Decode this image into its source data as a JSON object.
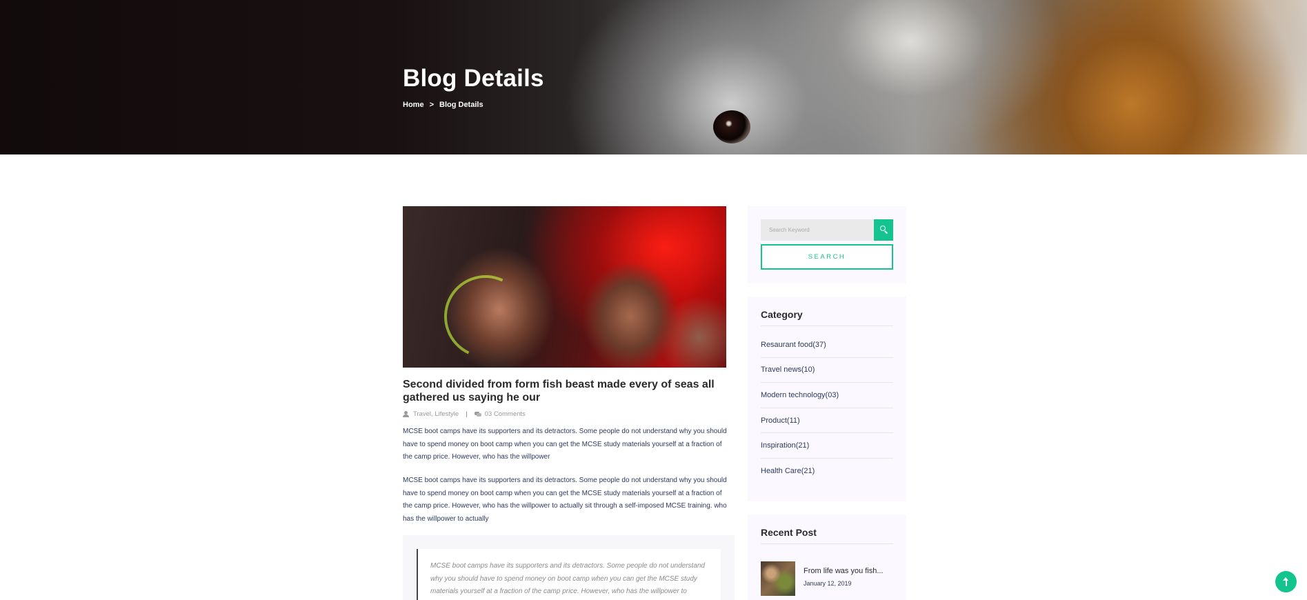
{
  "hero": {
    "title": "Blog Details",
    "breadcrumb": {
      "home": "Home",
      "separator": ">",
      "current": "Blog Details"
    }
  },
  "post": {
    "title": "Second divided from form fish beast made every of seas all gathered us saying he our",
    "meta": {
      "categories": "Travel, Lifestyle",
      "divider": "|",
      "comments": "03 Comments"
    },
    "paragraphs": [
      "MCSE boot camps have its supporters and its detractors. Some people do not understand why you should have to spend money on boot camp when you can get the MCSE study materials yourself at a fraction of the camp price. However, who has the willpower",
      "MCSE boot camps have its supporters and its detractors. Some people do not understand why you should have to spend money on boot camp when you can get the MCSE study materials yourself at a fraction of the camp price. However, who has the willpower to actually sit through a self-imposed MCSE training. who has the willpower to actually"
    ],
    "quote": "MCSE boot camps have its supporters and its detractors. Some people do not understand why you should have to spend money on boot camp when you can get the MCSE study materials yourself at a fraction of the camp price. However, who has the willpower to actually sit through a self-imposed MCSE training."
  },
  "sidebar": {
    "search": {
      "placeholder": "Search Keyword",
      "button_label": "SEARCH"
    },
    "category": {
      "title": "Category",
      "items": [
        {
          "label": "Resaurant food(37)"
        },
        {
          "label": "Travel news(10)"
        },
        {
          "label": "Modern technology(03)"
        },
        {
          "label": "Product(11)"
        },
        {
          "label": "Inspiration(21)"
        },
        {
          "label": "Health Care(21)"
        }
      ]
    },
    "recent": {
      "title": "Recent Post",
      "posts": [
        {
          "title": "From life was you fish...",
          "date": "January 12, 2019"
        }
      ]
    }
  },
  "colors": {
    "accent": "#13c48f",
    "text_dark": "#2a2a2a",
    "text_body": "#2d3a5c",
    "widget_bg": "#fbf9ff"
  },
  "icons": [
    "user-icon",
    "comment-icon",
    "search-icon",
    "arrow-up-icon"
  ]
}
